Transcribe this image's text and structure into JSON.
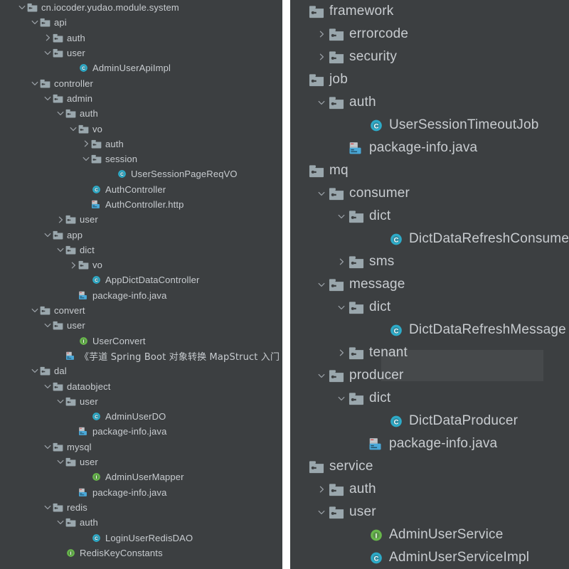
{
  "app": {
    "kind": "ide-project-tree",
    "colors": {
      "panel_background": "#3c3f41",
      "gap_background": "#ffffff",
      "text": "#c8ccd0",
      "arrow": "#9aa0a6",
      "folder_icon": "#9aa7ad",
      "class_icon": "#2dabc8",
      "interface_icon": "#68b84b",
      "http_file_icon": "#4aa8d8",
      "package_info_icon": "#4aa8d8",
      "highlight_artifact": "#46494b"
    },
    "icon_names": {
      "folder": "folder-icon",
      "class": "java-class-icon",
      "interface": "java-interface-icon",
      "http": "http-request-file-icon",
      "java": "java-file-icon",
      "chevron_right": "chevron-right-icon",
      "chevron_down": "chevron-down-icon"
    }
  },
  "left_panel": {
    "name": "project-tree-left",
    "rows": [
      {
        "label": "cn.iocoder.yudao.module.system",
        "icon": "folder",
        "arrow": "down",
        "depth": 1
      },
      {
        "label": "api",
        "icon": "folder",
        "arrow": "down",
        "depth": 2
      },
      {
        "label": "auth",
        "icon": "folder",
        "arrow": "right",
        "depth": 3
      },
      {
        "label": "user",
        "icon": "folder",
        "arrow": "down",
        "depth": 3
      },
      {
        "label": "AdminUserApiImpl",
        "icon": "class",
        "arrow": "none",
        "depth": 5
      },
      {
        "label": "controller",
        "icon": "folder",
        "arrow": "down",
        "depth": 2
      },
      {
        "label": "admin",
        "icon": "folder",
        "arrow": "down",
        "depth": 3
      },
      {
        "label": "auth",
        "icon": "folder",
        "arrow": "down",
        "depth": 4
      },
      {
        "label": "vo",
        "icon": "folder",
        "arrow": "down",
        "depth": 5
      },
      {
        "label": "auth",
        "icon": "folder",
        "arrow": "right",
        "depth": 6
      },
      {
        "label": "session",
        "icon": "folder",
        "arrow": "down",
        "depth": 6
      },
      {
        "label": "UserSessionPageReqVO",
        "icon": "class",
        "arrow": "none",
        "depth": 8
      },
      {
        "label": "AuthController",
        "icon": "class",
        "arrow": "none",
        "depth": 6
      },
      {
        "label": "AuthController.http",
        "icon": "http",
        "arrow": "none",
        "depth": 6
      },
      {
        "label": "user",
        "icon": "folder",
        "arrow": "right",
        "depth": 4
      },
      {
        "label": "app",
        "icon": "folder",
        "arrow": "down",
        "depth": 3
      },
      {
        "label": "dict",
        "icon": "folder",
        "arrow": "down",
        "depth": 4
      },
      {
        "label": "vo",
        "icon": "folder",
        "arrow": "right",
        "depth": 5
      },
      {
        "label": "AppDictDataController",
        "icon": "class",
        "arrow": "none",
        "depth": 6
      },
      {
        "label": "package-info.java",
        "icon": "java",
        "arrow": "none",
        "depth": 5
      },
      {
        "label": "convert",
        "icon": "folder",
        "arrow": "down",
        "depth": 2
      },
      {
        "label": "user",
        "icon": "folder",
        "arrow": "down",
        "depth": 3
      },
      {
        "label": "UserConvert",
        "icon": "interface",
        "arrow": "none",
        "depth": 5
      },
      {
        "label": "《芋道 Spring Boot 对象转换 MapStruct 入门",
        "icon": "http",
        "arrow": "none",
        "depth": 4,
        "cjk": true
      },
      {
        "label": "dal",
        "icon": "folder",
        "arrow": "down",
        "depth": 2
      },
      {
        "label": "dataobject",
        "icon": "folder",
        "arrow": "down",
        "depth": 3
      },
      {
        "label": "user",
        "icon": "folder",
        "arrow": "down",
        "depth": 4
      },
      {
        "label": "AdminUserDO",
        "icon": "class",
        "arrow": "none",
        "depth": 6
      },
      {
        "label": "package-info.java",
        "icon": "java",
        "arrow": "none",
        "depth": 5
      },
      {
        "label": "mysql",
        "icon": "folder",
        "arrow": "down",
        "depth": 3
      },
      {
        "label": "user",
        "icon": "folder",
        "arrow": "down",
        "depth": 4
      },
      {
        "label": "AdminUserMapper",
        "icon": "interface",
        "arrow": "none",
        "depth": 6
      },
      {
        "label": "package-info.java",
        "icon": "java",
        "arrow": "none",
        "depth": 5
      },
      {
        "label": "redis",
        "icon": "folder",
        "arrow": "down",
        "depth": 3
      },
      {
        "label": "auth",
        "icon": "folder",
        "arrow": "down",
        "depth": 4
      },
      {
        "label": "LoginUserRedisDAO",
        "icon": "class",
        "arrow": "none",
        "depth": 6
      },
      {
        "label": "RedisKeyConstants",
        "icon": "interface",
        "arrow": "none",
        "depth": 4
      }
    ]
  },
  "right_panel": {
    "name": "project-tree-right",
    "rows": [
      {
        "label": "framework",
        "icon": "folder",
        "arrow": "none",
        "depth": 0
      },
      {
        "label": "errorcode",
        "icon": "folder",
        "arrow": "right",
        "depth": 1
      },
      {
        "label": "security",
        "icon": "folder",
        "arrow": "right",
        "depth": 1
      },
      {
        "label": "job",
        "icon": "folder",
        "arrow": "none",
        "depth": 0
      },
      {
        "label": "auth",
        "icon": "folder",
        "arrow": "down",
        "depth": 1
      },
      {
        "label": "UserSessionTimeoutJob",
        "icon": "class",
        "arrow": "none",
        "depth": 3
      },
      {
        "label": "package-info.java",
        "icon": "java",
        "arrow": "none",
        "depth": 2
      },
      {
        "label": "mq",
        "icon": "folder",
        "arrow": "none",
        "depth": 0
      },
      {
        "label": "consumer",
        "icon": "folder",
        "arrow": "down",
        "depth": 1
      },
      {
        "label": "dict",
        "icon": "folder",
        "arrow": "down",
        "depth": 2
      },
      {
        "label": "DictDataRefreshConsumer",
        "icon": "class",
        "arrow": "none",
        "depth": 4
      },
      {
        "label": "sms",
        "icon": "folder",
        "arrow": "right",
        "depth": 2
      },
      {
        "label": "message",
        "icon": "folder",
        "arrow": "down",
        "depth": 1
      },
      {
        "label": "dict",
        "icon": "folder",
        "arrow": "down",
        "depth": 2
      },
      {
        "label": "DictDataRefreshMessage",
        "icon": "class",
        "arrow": "none",
        "depth": 4
      },
      {
        "label": "tenant",
        "icon": "folder",
        "arrow": "right",
        "depth": 2
      },
      {
        "label": "producer",
        "icon": "folder",
        "arrow": "down",
        "depth": 1
      },
      {
        "label": "dict",
        "icon": "folder",
        "arrow": "down",
        "depth": 2
      },
      {
        "label": "DictDataProducer",
        "icon": "class",
        "arrow": "none",
        "depth": 4
      },
      {
        "label": "package-info.java",
        "icon": "java",
        "arrow": "none",
        "depth": 3
      },
      {
        "label": "service",
        "icon": "folder",
        "arrow": "none",
        "depth": 0
      },
      {
        "label": "auth",
        "icon": "folder",
        "arrow": "right",
        "depth": 1
      },
      {
        "label": "user",
        "icon": "folder",
        "arrow": "down",
        "depth": 1
      },
      {
        "label": "AdminUserService",
        "icon": "interface",
        "arrow": "none",
        "depth": 3
      },
      {
        "label": "AdminUserServiceImpl",
        "icon": "class",
        "arrow": "none",
        "depth": 3
      }
    ]
  }
}
